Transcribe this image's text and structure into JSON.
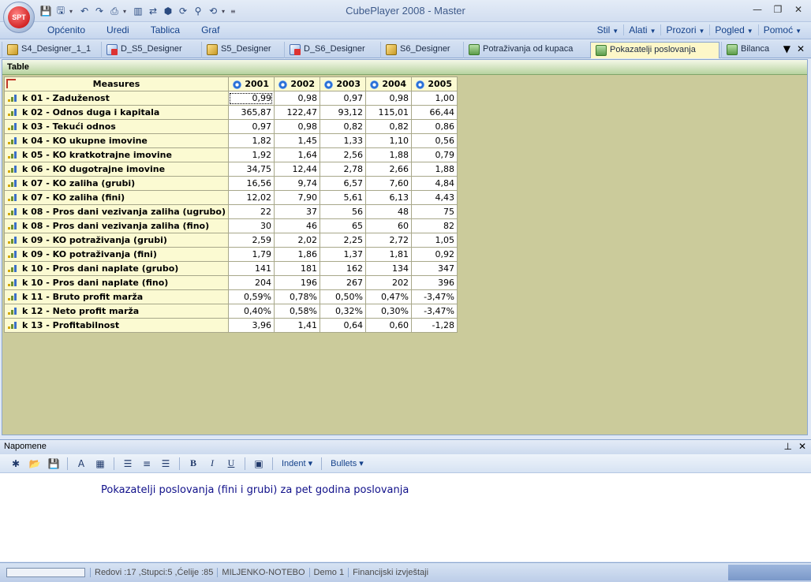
{
  "window": {
    "title": "CubePlayer 2008 - Master",
    "orb_label": "SPT",
    "controls": {
      "minimize": "—",
      "restore": "❐",
      "close": "✕"
    }
  },
  "quick_access": [
    {
      "name": "save-icon",
      "glyph": "💾"
    },
    {
      "name": "save-as-icon",
      "glyph": "🖫"
    },
    {
      "name": "undo-icon",
      "glyph": "↶"
    },
    {
      "name": "redo-icon",
      "glyph": "↷"
    },
    {
      "name": "print-icon",
      "glyph": "⎙"
    },
    {
      "name": "chart-icon",
      "glyph": "▥"
    },
    {
      "name": "swap-icon",
      "glyph": "⇄"
    },
    {
      "name": "cube-icon",
      "glyph": "⬢"
    },
    {
      "name": "refresh-icon",
      "glyph": "⟳"
    },
    {
      "name": "filter-icon",
      "glyph": "⚲"
    },
    {
      "name": "reset-icon",
      "glyph": "⟲"
    }
  ],
  "menu": {
    "left": [
      "Općenito",
      "Uredi",
      "Tablica",
      "Graf"
    ],
    "right": [
      "Stil",
      "Alati",
      "Prozori",
      "Pogled",
      "Pomoć"
    ]
  },
  "tabs": [
    {
      "label": "S4_Designer_1_1",
      "icon": "cube"
    },
    {
      "label": "D_S5_Designer",
      "icon": "designer"
    },
    {
      "label": "S5_Designer",
      "icon": "cube"
    },
    {
      "label": "D_S6_Designer",
      "icon": "designer"
    },
    {
      "label": "S6_Designer",
      "icon": "cube"
    },
    {
      "label": "Potraživanja od kupaca",
      "icon": "sheet"
    },
    {
      "label": "Pokazatelji poslovanja",
      "icon": "sheet",
      "active": true
    },
    {
      "label": "Bilanca",
      "icon": "sheet"
    }
  ],
  "panel_title": "Table",
  "table": {
    "header": "Measures",
    "years": [
      "2001",
      "2002",
      "2003",
      "2004",
      "2005"
    ],
    "rows": [
      {
        "label": "k 01 - Zaduženost",
        "values": [
          "0,99",
          "0,98",
          "0,97",
          "0,98",
          "1,00"
        ]
      },
      {
        "label": "k 02 - Odnos duga i kapitala",
        "values": [
          "365,87",
          "122,47",
          "93,12",
          "115,01",
          "66,44"
        ]
      },
      {
        "label": "k 03 - Tekući odnos",
        "values": [
          "0,97",
          "0,98",
          "0,82",
          "0,82",
          "0,86"
        ]
      },
      {
        "label": "k 04 - KO ukupne imovine",
        "values": [
          "1,82",
          "1,45",
          "1,33",
          "1,10",
          "0,56"
        ]
      },
      {
        "label": "k 05 - KO kratkotrajne imovine",
        "values": [
          "1,92",
          "1,64",
          "2,56",
          "1,88",
          "0,79"
        ]
      },
      {
        "label": "k 06 - KO dugotrajne imovine",
        "values": [
          "34,75",
          "12,44",
          "2,78",
          "2,66",
          "1,88"
        ]
      },
      {
        "label": "k 07 - KO zaliha (grubi)",
        "values": [
          "16,56",
          "9,74",
          "6,57",
          "7,60",
          "4,84"
        ]
      },
      {
        "label": "k 07 - KO zaliha (fini)",
        "values": [
          "12,02",
          "7,90",
          "5,61",
          "6,13",
          "4,43"
        ]
      },
      {
        "label": "k 08 - Pros dani vezivanja zaliha (ugrubo)",
        "values": [
          "22",
          "37",
          "56",
          "48",
          "75"
        ]
      },
      {
        "label": "k 08 - Pros dani vezivanja zaliha (fino)",
        "values": [
          "30",
          "46",
          "65",
          "60",
          "82"
        ]
      },
      {
        "label": "k 09 - KO potraživanja (grubi)",
        "values": [
          "2,59",
          "2,02",
          "2,25",
          "2,72",
          "1,05"
        ]
      },
      {
        "label": "k 09 - KO potraživanja (fini)",
        "values": [
          "1,79",
          "1,86",
          "1,37",
          "1,81",
          "0,92"
        ]
      },
      {
        "label": "k 10 - Pros dani naplate (grubo)",
        "values": [
          "141",
          "181",
          "162",
          "134",
          "347"
        ]
      },
      {
        "label": "k 10 - Pros dani naplate (fino)",
        "values": [
          "204",
          "196",
          "267",
          "202",
          "396"
        ]
      },
      {
        "label": "k 11 - Bruto profit marža",
        "values": [
          "0,59%",
          "0,78%",
          "0,50%",
          "0,47%",
          "-3,47%"
        ]
      },
      {
        "label": "k 12 - Neto profit marža",
        "values": [
          "0,40%",
          "0,58%",
          "0,32%",
          "0,30%",
          "-3,47%"
        ]
      },
      {
        "label": "k 13 - Profitabilnost",
        "values": [
          "3,96",
          "1,41",
          "0,64",
          "0,60",
          "-1,28"
        ]
      }
    ]
  },
  "notes": {
    "title": "Napomene",
    "indent_label": "Indent",
    "bullets_label": "Bullets",
    "text": "Pokazatelji poslovanja (fini i grubi) za pet godina poslovanja"
  },
  "status": {
    "counts": "Redovi :17 ,Stupci:5 ,Ćelije :85",
    "machine": "MILJENKO-NOTEBO",
    "demo": "Demo 1",
    "model": "Financijski izvještaji"
  }
}
